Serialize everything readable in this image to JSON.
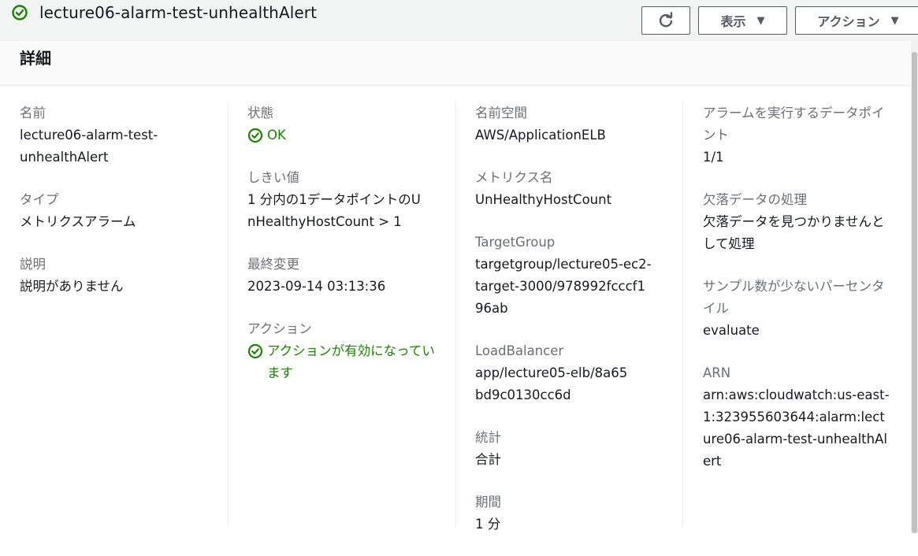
{
  "header": {
    "title": "lecture06-alarm-test-unhealthAlert",
    "view_label": "表示",
    "actions_label": "アクション"
  },
  "panel": {
    "title": "詳細"
  },
  "col1": {
    "name_label": "名前",
    "name_value": "lecture06-alarm-test-unhealthAlert",
    "type_label": "タイプ",
    "type_value": "メトリクスアラーム",
    "desc_label": "説明",
    "desc_value": "説明がありません"
  },
  "col2": {
    "state_label": "状態",
    "state_value": "OK",
    "threshold_label": "しきい値",
    "threshold_value": "1 分内の1データポイントのUnHealthyHostCount > 1",
    "last_change_label": "最終変更",
    "last_change_value": "2023-09-14 03:13:36",
    "actions_label": "アクション",
    "actions_value": "アクションが有効になっています"
  },
  "col3": {
    "namespace_label": "名前空間",
    "namespace_value": "AWS/ApplicationELB",
    "metric_label": "メトリクス名",
    "metric_value": "UnHealthyHostCount",
    "tg_label": "TargetGroup",
    "tg_value": "targetgroup/lecture05-ec2-target-3000/978992fcccf196ab",
    "lb_label": "LoadBalancer",
    "lb_value": "app/lecture05-elb/8a65bd9c0130cc6d",
    "stat_label": "統計",
    "stat_value": "合計",
    "period_label": "期間",
    "period_value": "1 分"
  },
  "col4": {
    "datapoints_label": "アラームを実行するデータポイント",
    "datapoints_value": "1/1",
    "missing_label": "欠落データの処理",
    "missing_value": "欠落データを見つかりませんとして処理",
    "percentile_label": "サンプル数が少ないパーセンタイル",
    "percentile_value": "evaluate",
    "arn_label": "ARN",
    "arn_value": "arn:aws:cloudwatch:us-east-1:323955603644:alarm:lecture06-alarm-test-unhealthAlert"
  },
  "colors": {
    "ok_green": "#1d8102",
    "label_gray": "#687078",
    "text": "#16191f"
  },
  "icons": [
    "check-circle-icon",
    "refresh-icon",
    "caret-down-icon"
  ]
}
